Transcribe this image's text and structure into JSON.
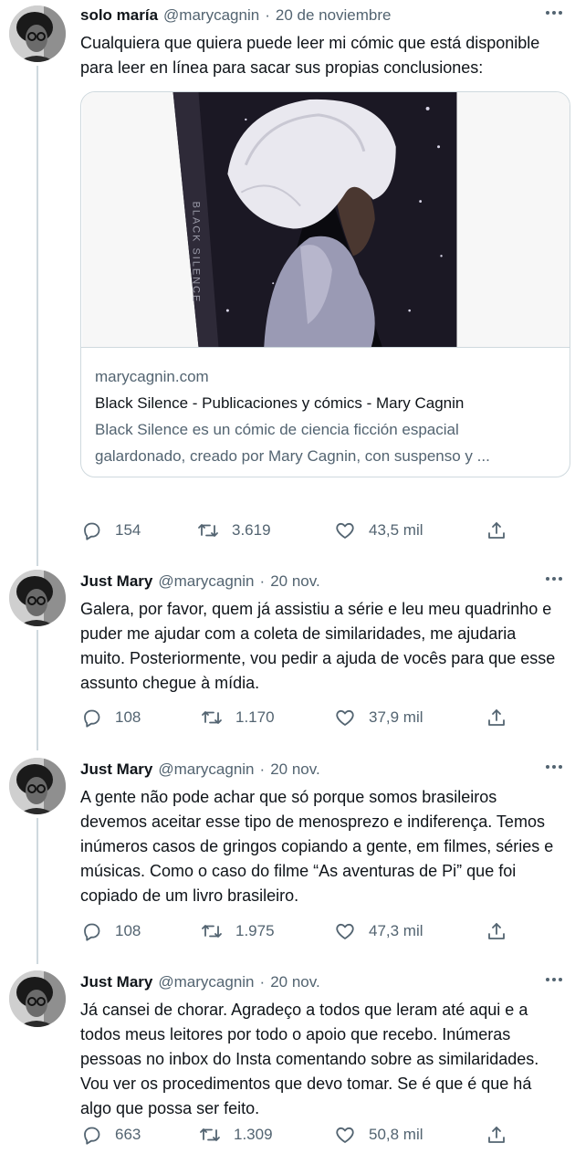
{
  "tweets": [
    {
      "name": "solo maría",
      "handle": "@marycagnin",
      "dot": "·",
      "date": "20 de noviembre",
      "text": "Cualquiera que quiera puede leer mi cómic que está disponible para leer en línea para sacar sus propias conclusiones:",
      "card": {
        "domain": "marycagnin.com",
        "title": "Black Silence - Publicaciones y cómics - Mary Cagnin",
        "desc_line1": "Black Silence es un cómic de ciencia ficción espacial",
        "desc_line2": "galardonado, creado por Mary Cagnin, con suspenso y ...",
        "cover_spine_text": "BLACK SILENCE"
      },
      "replies": "154",
      "retweets": "3.619",
      "likes": "43,5 mil"
    },
    {
      "name": "Just Mary",
      "handle": "@marycagnin",
      "dot": "·",
      "date": "20 nov.",
      "text": "Galera, por favor, quem já assistiu a série e leu meu quadrinho e puder me ajudar com a coleta de similaridades, me ajudaria muito. Posteriormente, vou pedir a ajuda de vocês para que esse assunto chegue à mídia.",
      "replies": "108",
      "retweets": "1.170",
      "likes": "37,9 mil"
    },
    {
      "name": "Just Mary",
      "handle": "@marycagnin",
      "dot": "·",
      "date": "20 nov.",
      "text": "A gente não pode achar que só porque somos brasileiros devemos aceitar esse tipo de menosprezo e indiferença. Temos inúmeros casos de gringos copiando a gente, em filmes, séries e músicas. Como o caso do filme “As aventuras de Pi” que foi copiado de um livro brasileiro.",
      "replies": "108",
      "retweets": "1.975",
      "likes": "47,3 mil"
    },
    {
      "name": "Just Mary",
      "handle": "@marycagnin",
      "dot": "·",
      "date": "20 nov.",
      "text": "Já cansei de chorar. Agradeço a todos que leram até aqui e a todos meus leitores por todo o apoio que recebo. Inúmeras pessoas no inbox do Insta comentando sobre as similaridades. Vou ver os procedimentos que devo tomar. Se é que é que há algo que possa ser feito.",
      "replies": "663",
      "retweets": "1.309",
      "likes": "50,8 mil"
    }
  ],
  "icons": {
    "reply": "reply-icon",
    "retweet": "retweet-icon",
    "like": "heart-icon",
    "share": "share-icon",
    "more": "more-options-icon"
  },
  "colors": {
    "text": "#0f1419",
    "secondary": "#536471",
    "border": "#cfd9de"
  }
}
